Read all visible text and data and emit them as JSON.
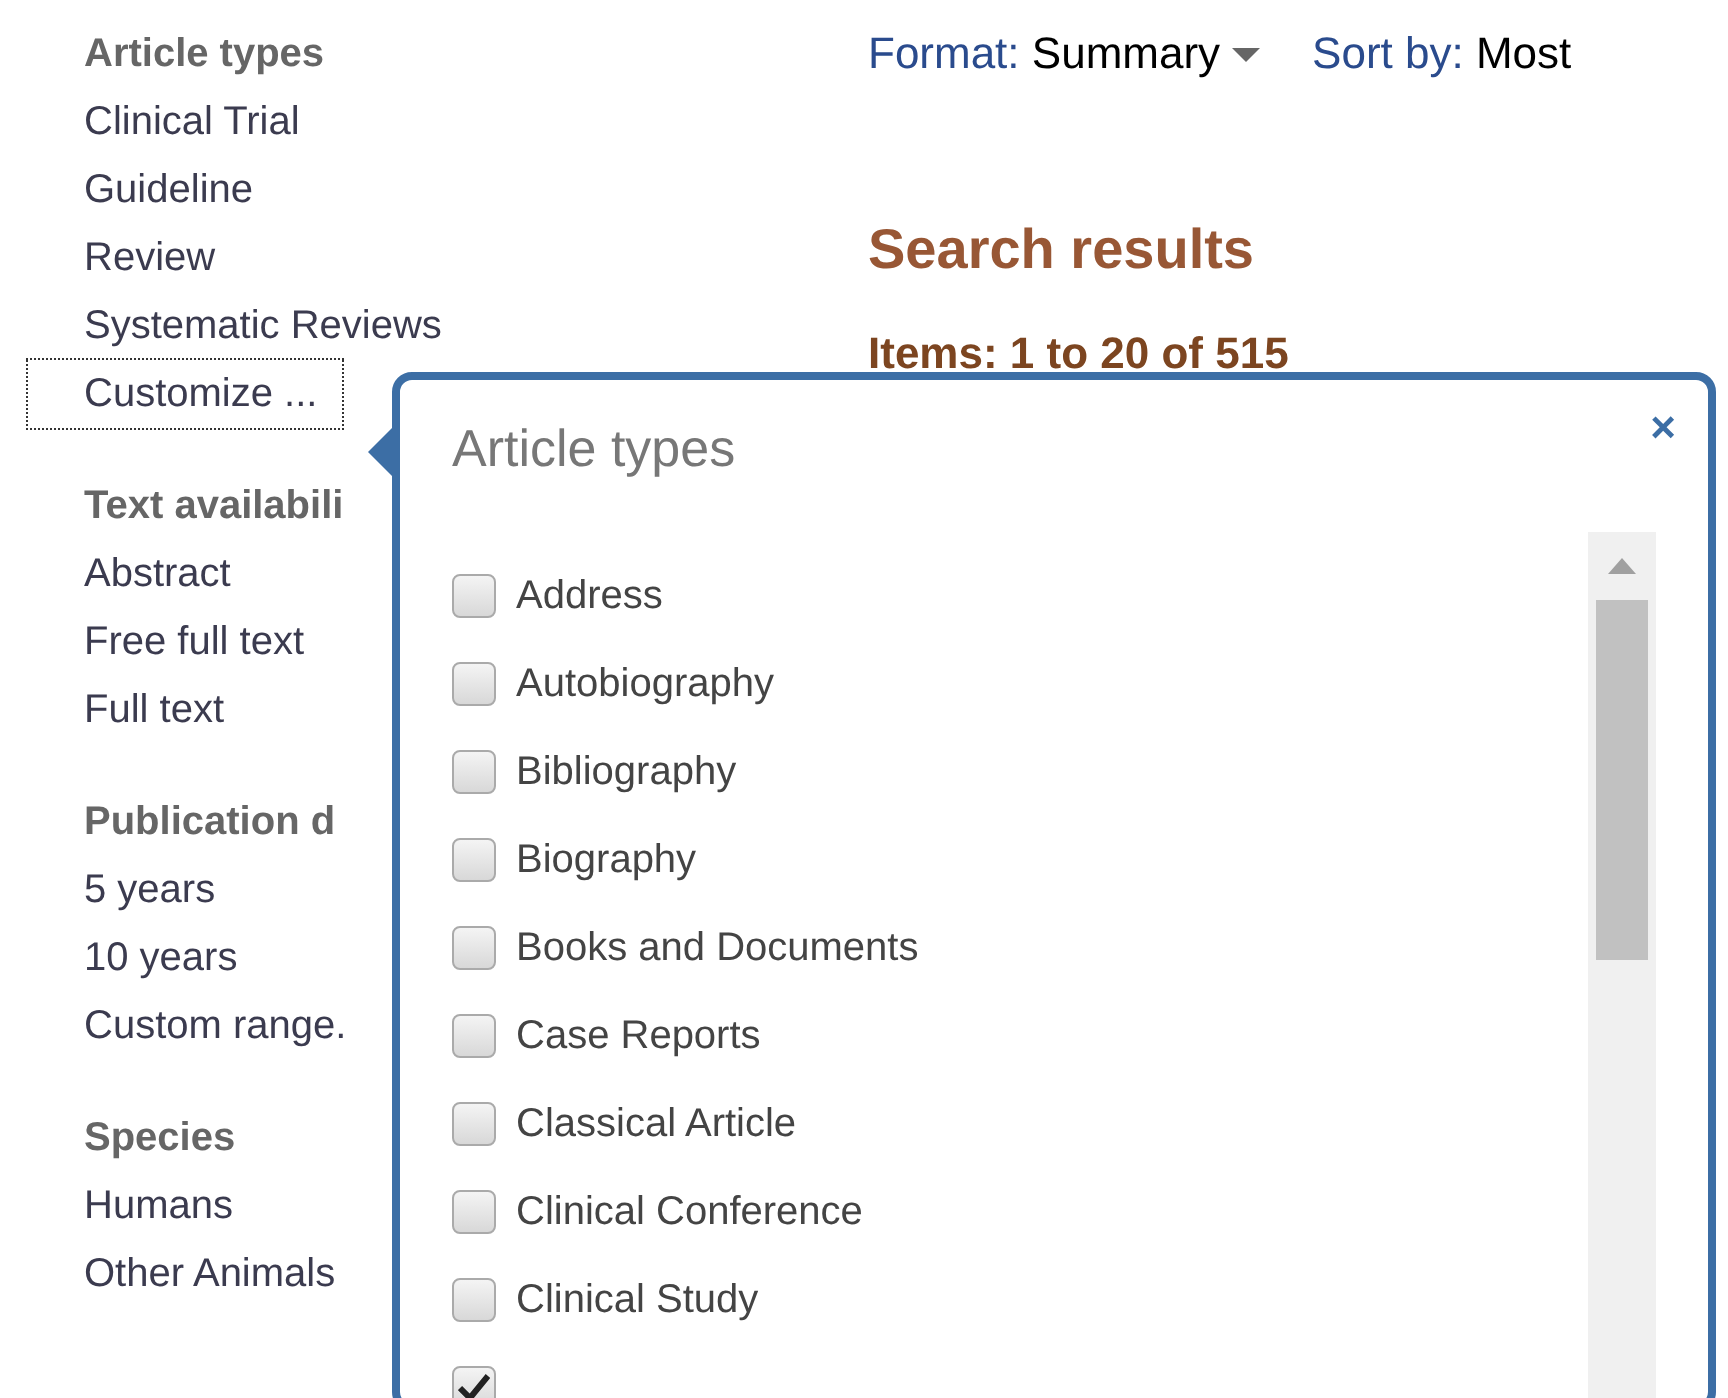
{
  "sidebar": {
    "groups": [
      {
        "heading": "Article types",
        "items": [
          {
            "label": "Clinical Trial",
            "kind": "link"
          },
          {
            "label": "Guideline",
            "kind": "link"
          },
          {
            "label": "Review",
            "kind": "link"
          },
          {
            "label": "Systematic Reviews",
            "kind": "link"
          },
          {
            "label": "Customize ...",
            "kind": "focused"
          }
        ]
      },
      {
        "heading": "Text availabili",
        "items": [
          {
            "label": "Abstract",
            "kind": "link"
          },
          {
            "label": "Free full text",
            "kind": "link"
          },
          {
            "label": "Full text",
            "kind": "link"
          }
        ]
      },
      {
        "heading": "Publication d",
        "items": [
          {
            "label": "5 years",
            "kind": "link"
          },
          {
            "label": "10 years",
            "kind": "link"
          },
          {
            "label": "Custom range.",
            "kind": "link"
          }
        ]
      },
      {
        "heading": "Species",
        "items": [
          {
            "label": "Humans",
            "kind": "link"
          },
          {
            "label": "Other Animals",
            "kind": "link"
          }
        ]
      }
    ]
  },
  "toolbar": {
    "format_label": "Format:",
    "format_value": "Summary",
    "sort_label": "Sort by:",
    "sort_value": "Most"
  },
  "results": {
    "heading": "Search results",
    "count": "Items: 1 to 20 of 515"
  },
  "popover": {
    "title": "Article types",
    "close": "×",
    "options": [
      {
        "label": "Address",
        "checked": false
      },
      {
        "label": "Autobiography",
        "checked": false
      },
      {
        "label": "Bibliography",
        "checked": false
      },
      {
        "label": "Biography",
        "checked": false
      },
      {
        "label": "Books and Documents",
        "checked": false
      },
      {
        "label": "Case Reports",
        "checked": false
      },
      {
        "label": "Classical Article",
        "checked": false
      },
      {
        "label": "Clinical Conference",
        "checked": false
      },
      {
        "label": "Clinical Study",
        "checked": false
      },
      {
        "checked": true
      }
    ]
  }
}
